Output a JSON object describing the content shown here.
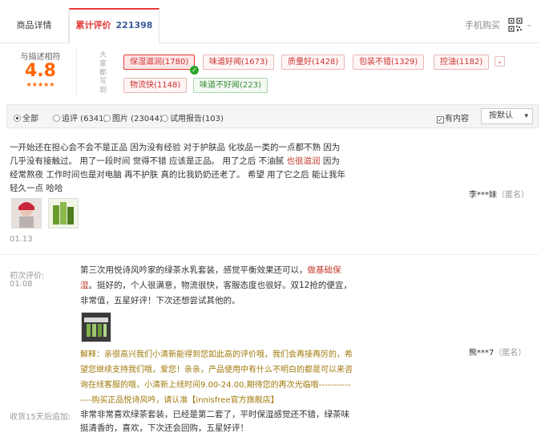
{
  "tabs": {
    "detail_label": "商品详情",
    "reviews_label": "累计评价",
    "reviews_count": "221398",
    "mobile_buy": "手机购买"
  },
  "score": {
    "label": "与描述相符",
    "value": "4.8",
    "stars": "★★★★★",
    "vertical_label": "大家都写到"
  },
  "tags": [
    {
      "label": "保湿滋润(1780)",
      "sentiment": "positive",
      "selected": true
    },
    {
      "label": "味道好闻(1673)",
      "sentiment": "positive",
      "selected": false
    },
    {
      "label": "质量好(1428)",
      "sentiment": "positive",
      "selected": false
    },
    {
      "label": "包装不错(1329)",
      "sentiment": "positive",
      "selected": false
    },
    {
      "label": "控油(1182)",
      "sentiment": "positive",
      "selected": false
    },
    {
      "label": "物流快(1148)",
      "sentiment": "positive",
      "selected": false
    },
    {
      "label": "味道不好闻(223)",
      "sentiment": "negative",
      "selected": false
    }
  ],
  "filters": {
    "all": "全部",
    "append": "追评 (6341)",
    "images": "图片 (23044)",
    "trial": "试用报告(103)",
    "selected": "all",
    "has_content_label": "有内容",
    "has_content_checked": true,
    "sort_label": "按默认"
  },
  "reviews": [
    {
      "text_before": "一开始还在担心会不会不是正品 因为没有经验 对于护肤品 化妆品一类的一点都不熟 因为几乎没有接触过。 用了一段时间 觉得不错 应该是正品。 用了之后 不油腻 ",
      "highlight": "也很滋润",
      "text_after": " 因为经常熬夜 工作时间也是对电脑 再不护肤 真的比我奶奶还老了。 希望 用了它之后 能让我年轻久一点 哈哈",
      "date": "01.13",
      "author": "李***妹",
      "anon": "（匿名）"
    },
    {
      "initial_label": "初次评价:",
      "date": "01.08",
      "text_before": "第三次用悦诗风吟家的绿茶水乳套装，感觉平衡效果还可以，",
      "highlight": "做基础保湿",
      "text_after": "。挺好的，个人很满意，物流很快，客服态度也很好。双12抢的便宜，非常值，五星好评！下次还想尝试其他的。",
      "reply": "解释：亲很高兴我们小清新能得到您如此高的评价哦，我们会再接再厉的，希望您继续支持我们哦，爱您！亲亲，产品使用中有什么不明白的都是可以来咨询在线客服的哦，小清新上线时间9.00-24.00,期待您的再次光临哦---------------购买正品悦诗风吟，请认准【innisfree官方旗舰店】",
      "append_label": "收货15天后追加:",
      "append_text": "非常非常喜欢绿茶套装，已经是第二套了，平时保湿感觉还不错，绿茶味挺清香的，喜欢，下次还会回购，五星好评！",
      "author": "熊***7",
      "anon": "（匿名）"
    }
  ]
}
